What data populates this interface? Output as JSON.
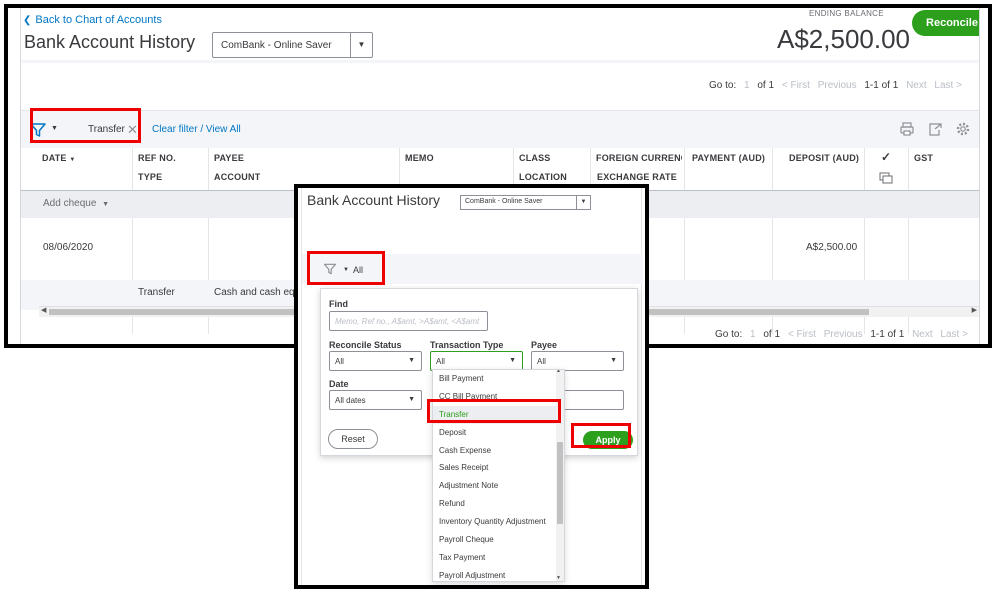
{
  "main": {
    "back_link": "Back to Chart of Accounts",
    "title": "Bank Account History",
    "account_select": "ComBank - Online Saver",
    "ending_balance_label": "ENDING BALANCE",
    "ending_balance": "A$2,500.00",
    "reconcile": "Reconcile",
    "pager": {
      "goto": "Go to:",
      "page": "1",
      "of": "of 1",
      "first": "< First",
      "previous": "Previous",
      "range": "1-1 of 1",
      "next": "Next",
      "last": "Last >"
    },
    "filter": {
      "chip": "Transfer",
      "clear": "Clear filter / View All"
    },
    "columns": {
      "date": "DATE",
      "ref_no": "REF NO.",
      "type": "TYPE",
      "payee": "PAYEE",
      "account": "ACCOUNT",
      "memo": "MEMO",
      "class": "CLASS",
      "location": "LOCATION",
      "foreign_currency": "FOREIGN CURRENC",
      "exchange_rate": "EXCHANGE RATE",
      "payment": "PAYMENT (AUD)",
      "deposit": "DEPOSIT (AUD)",
      "check": "✓",
      "gst": "GST"
    },
    "add_cheque": "Add cheque",
    "row": {
      "date": "08/06/2020",
      "deposit": "A$2,500.00",
      "type": "Transfer",
      "account": "Cash and cash equ"
    }
  },
  "popup": {
    "title": "Bank Account History",
    "account_select": "ComBank - Online Saver",
    "filter_all": "All",
    "find_label": "Find",
    "find_placeholder": "Memo, Ref no., A$amt, >A$amt, <A$amt",
    "reconcile_status_label": "Reconcile Status",
    "reconcile_status_value": "All",
    "transaction_type_label": "Transaction Type",
    "transaction_type_value": "All",
    "payee_label": "Payee",
    "payee_value": "All",
    "date_label": "Date",
    "date_value": "All dates",
    "reset": "Reset",
    "apply": "Apply",
    "transaction_types": [
      "Bill Payment",
      "CC Bill Payment",
      "Transfer",
      "Deposit",
      "Cash Expense",
      "Sales Receipt",
      "Adjustment Note",
      "Refund",
      "Inventory Quantity Adjustment",
      "Payroll Cheque",
      "Tax Payment",
      "Payroll Adjustment"
    ],
    "selected_type": "Transfer"
  },
  "colors": {
    "accent_green": "#2ca01c",
    "link_blue": "#0077c5",
    "highlight_red": "#e00000"
  }
}
